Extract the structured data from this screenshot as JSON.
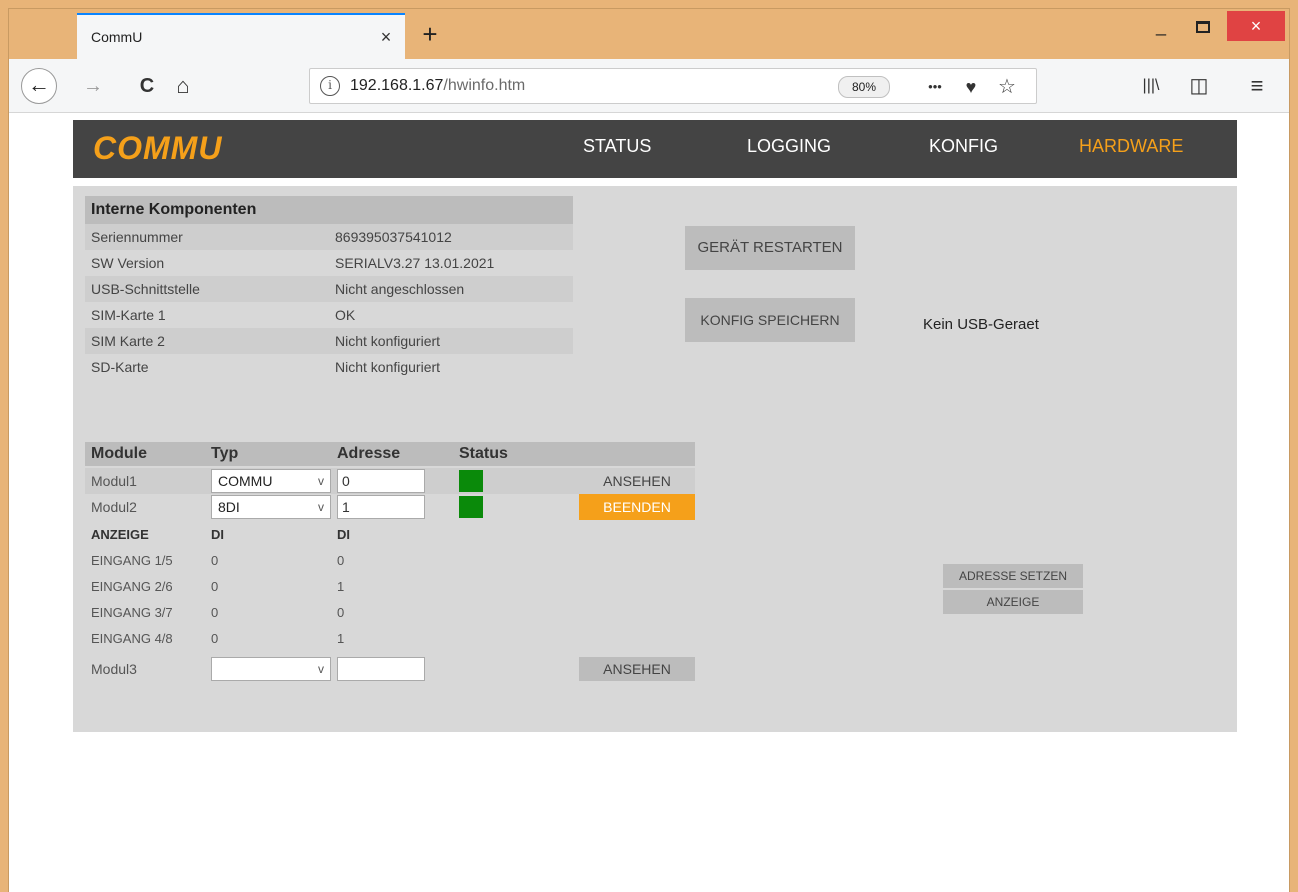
{
  "browser": {
    "tab_title": "CommU",
    "tab_close": "×",
    "new_tab": "+",
    "win_min": "_",
    "win_close": "×",
    "url_host": "192.168.1.67",
    "url_path": "/hwinfo.htm",
    "zoom": "80%",
    "url_info": "i",
    "icons": {
      "back": "←",
      "forward": "→",
      "reload": "C",
      "home": "⌂",
      "more": "•••",
      "pocket": "♥",
      "star": "☆",
      "library": "|||\\",
      "sidebar": "◫",
      "menu": "≡"
    }
  },
  "site": {
    "logo": "COMMU",
    "menu": [
      "STATUS",
      "LOGGING",
      "KONFIG",
      "HARDWARE"
    ],
    "active_menu": "HARDWARE"
  },
  "komponenten": {
    "title": "Interne Komponenten",
    "rows": [
      {
        "label": "Seriennummer",
        "value": "869395037541012"
      },
      {
        "label": "SW Version",
        "value": "SERIALV3.27 13.01.2021"
      },
      {
        "label": "USB-Schnittstelle",
        "value": "Nicht angeschlossen"
      },
      {
        "label": "SIM-Karte 1",
        "value": "OK"
      },
      {
        "label": "SIM Karte 2",
        "value": "Nicht konfiguriert"
      },
      {
        "label": "SD-Karte",
        "value": "Nicht konfiguriert"
      }
    ]
  },
  "actions": {
    "restart": "GERÄT RESTARTEN",
    "save_config": "KONFIG SPEICHERN",
    "usb_message": "Kein USB-Geraet",
    "set_address": "ADRESSE SETZEN",
    "display": "ANZEIGE"
  },
  "modules": {
    "headers": {
      "module": "Module",
      "typ": "Typ",
      "adresse": "Adresse",
      "status": "Status"
    },
    "rows": [
      {
        "label": "Modul1",
        "typ": "COMMU",
        "adresse": "0",
        "status_color": "#0a8a0a",
        "button": "ANSEHEN"
      },
      {
        "label": "Modul2",
        "typ": "8DI",
        "adresse": "1",
        "status_color": "#0a8a0a",
        "button": "BEENDEN"
      },
      {
        "label": "Modul3",
        "typ": "",
        "adresse": "",
        "button": "ANSEHEN"
      }
    ],
    "select_arrow": "v",
    "anzeige": {
      "header": [
        "ANZEIGE",
        "DI",
        "DI"
      ],
      "rows": [
        [
          "EINGANG 1/5",
          "0",
          "0"
        ],
        [
          "EINGANG 2/6",
          "0",
          "1"
        ],
        [
          "EINGANG 3/7",
          "0",
          "0"
        ],
        [
          "EINGANG 4/8",
          "0",
          "1"
        ]
      ]
    }
  },
  "colors": {
    "accent": "#f5a01a",
    "header_bg": "#444444",
    "panel_bg": "#d8d8d8",
    "status_ok": "#0a8a0a"
  }
}
